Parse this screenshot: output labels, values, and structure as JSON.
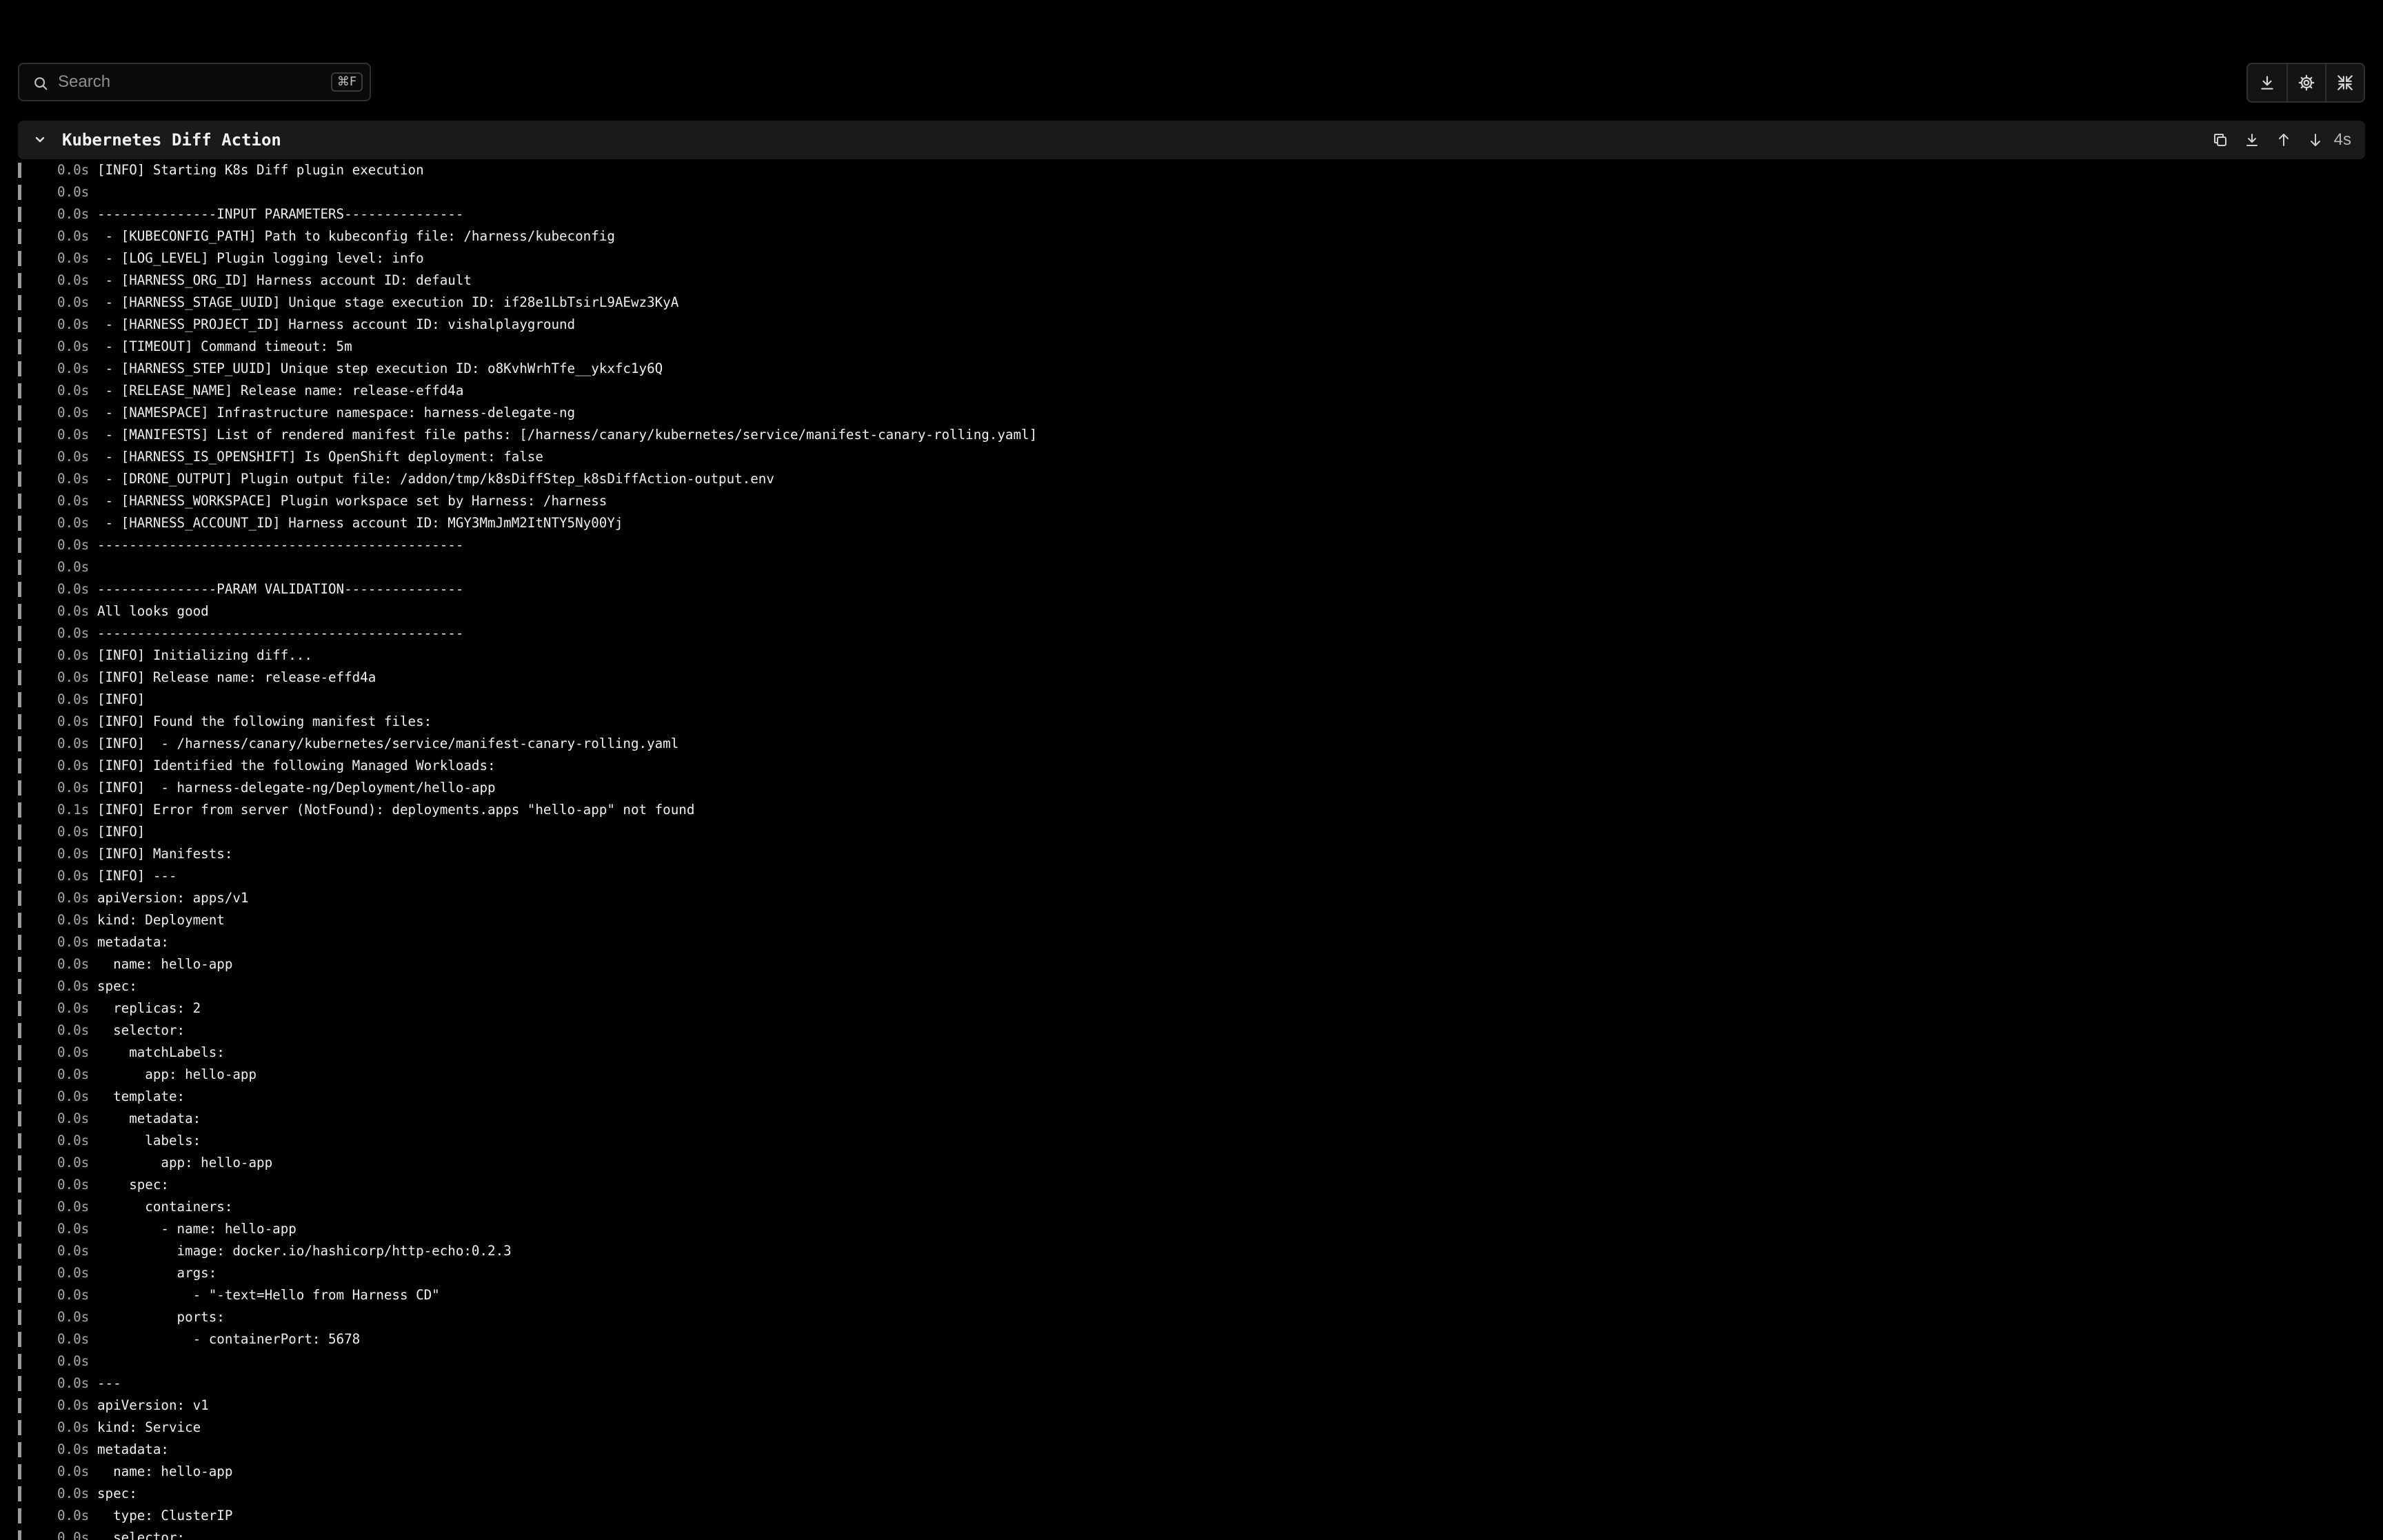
{
  "search": {
    "placeholder": "Search",
    "shortcut": "⌘F"
  },
  "toolbar": {
    "download_icon": "download-icon",
    "settings_icon": "gear-icon",
    "collapse_icon": "collapse-arrows-icon"
  },
  "section": {
    "title": "Kubernetes Diff Action",
    "duration": "4s"
  },
  "colors": {
    "background": "#000000",
    "header_bg": "#1a1a1a",
    "text": "#f0f0f0",
    "muted": "#a8a8a8"
  },
  "log": [
    {
      "time": "0.0s",
      "text": "[INFO] Starting K8s Diff plugin execution"
    },
    {
      "time": "0.0s",
      "text": ""
    },
    {
      "time": "0.0s",
      "text": "---------------INPUT PARAMETERS---------------"
    },
    {
      "time": "0.0s",
      "text": " - [KUBECONFIG_PATH] Path to kubeconfig file: /harness/kubeconfig"
    },
    {
      "time": "0.0s",
      "text": " - [LOG_LEVEL] Plugin logging level: info"
    },
    {
      "time": "0.0s",
      "text": " - [HARNESS_ORG_ID] Harness account ID: default"
    },
    {
      "time": "0.0s",
      "text": " - [HARNESS_STAGE_UUID] Unique stage execution ID: if28e1LbTsirL9AEwz3KyA"
    },
    {
      "time": "0.0s",
      "text": " - [HARNESS_PROJECT_ID] Harness account ID: vishalplayground"
    },
    {
      "time": "0.0s",
      "text": " - [TIMEOUT] Command timeout: 5m"
    },
    {
      "time": "0.0s",
      "text": " - [HARNESS_STEP_UUID] Unique step execution ID: o8KvhWrhTfe__ykxfc1y6Q"
    },
    {
      "time": "0.0s",
      "text": " - [RELEASE_NAME] Release name: release-effd4a"
    },
    {
      "time": "0.0s",
      "text": " - [NAMESPACE] Infrastructure namespace: harness-delegate-ng"
    },
    {
      "time": "0.0s",
      "text": " - [MANIFESTS] List of rendered manifest file paths: [/harness/canary/kubernetes/service/manifest-canary-rolling.yaml]"
    },
    {
      "time": "0.0s",
      "text": " - [HARNESS_IS_OPENSHIFT] Is OpenShift deployment: false"
    },
    {
      "time": "0.0s",
      "text": " - [DRONE_OUTPUT] Plugin output file: /addon/tmp/k8sDiffStep_k8sDiffAction-output.env"
    },
    {
      "time": "0.0s",
      "text": " - [HARNESS_WORKSPACE] Plugin workspace set by Harness: /harness"
    },
    {
      "time": "0.0s",
      "text": " - [HARNESS_ACCOUNT_ID] Harness account ID: MGY3MmJmM2ItNTY5Ny00Yj"
    },
    {
      "time": "0.0s",
      "text": "----------------------------------------------"
    },
    {
      "time": "0.0s",
      "text": ""
    },
    {
      "time": "0.0s",
      "text": "---------------PARAM VALIDATION---------------"
    },
    {
      "time": "0.0s",
      "text": "All looks good"
    },
    {
      "time": "0.0s",
      "text": "----------------------------------------------"
    },
    {
      "time": "0.0s",
      "text": "[INFO] Initializing diff..."
    },
    {
      "time": "0.0s",
      "text": "[INFO] Release name: release-effd4a"
    },
    {
      "time": "0.0s",
      "text": "[INFO]"
    },
    {
      "time": "0.0s",
      "text": "[INFO] Found the following manifest files:"
    },
    {
      "time": "0.0s",
      "text": "[INFO]  - /harness/canary/kubernetes/service/manifest-canary-rolling.yaml"
    },
    {
      "time": "0.0s",
      "text": "[INFO] Identified the following Managed Workloads:"
    },
    {
      "time": "0.0s",
      "text": "[INFO]  - harness-delegate-ng/Deployment/hello-app"
    },
    {
      "time": "0.1s",
      "text": "[INFO] Error from server (NotFound): deployments.apps \"hello-app\" not found"
    },
    {
      "time": "0.0s",
      "text": "[INFO]"
    },
    {
      "time": "0.0s",
      "text": "[INFO] Manifests:"
    },
    {
      "time": "0.0s",
      "text": "[INFO] ---"
    },
    {
      "time": "0.0s",
      "text": "apiVersion: apps/v1"
    },
    {
      "time": "0.0s",
      "text": "kind: Deployment"
    },
    {
      "time": "0.0s",
      "text": "metadata:"
    },
    {
      "time": "0.0s",
      "text": "  name: hello-app"
    },
    {
      "time": "0.0s",
      "text": "spec:"
    },
    {
      "time": "0.0s",
      "text": "  replicas: 2"
    },
    {
      "time": "0.0s",
      "text": "  selector:"
    },
    {
      "time": "0.0s",
      "text": "    matchLabels:"
    },
    {
      "time": "0.0s",
      "text": "      app: hello-app"
    },
    {
      "time": "0.0s",
      "text": "  template:"
    },
    {
      "time": "0.0s",
      "text": "    metadata:"
    },
    {
      "time": "0.0s",
      "text": "      labels:"
    },
    {
      "time": "0.0s",
      "text": "        app: hello-app"
    },
    {
      "time": "0.0s",
      "text": "    spec:"
    },
    {
      "time": "0.0s",
      "text": "      containers:"
    },
    {
      "time": "0.0s",
      "text": "        - name: hello-app"
    },
    {
      "time": "0.0s",
      "text": "          image: docker.io/hashicorp/http-echo:0.2.3"
    },
    {
      "time": "0.0s",
      "text": "          args:"
    },
    {
      "time": "0.0s",
      "text": "            - \"-text=Hello from Harness CD\""
    },
    {
      "time": "0.0s",
      "text": "          ports:"
    },
    {
      "time": "0.0s",
      "text": "            - containerPort: 5678"
    },
    {
      "time": "0.0s",
      "text": ""
    },
    {
      "time": "0.0s",
      "text": "---"
    },
    {
      "time": "0.0s",
      "text": "apiVersion: v1"
    },
    {
      "time": "0.0s",
      "text": "kind: Service"
    },
    {
      "time": "0.0s",
      "text": "metadata:"
    },
    {
      "time": "0.0s",
      "text": "  name: hello-app"
    },
    {
      "time": "0.0s",
      "text": "spec:"
    },
    {
      "time": "0.0s",
      "text": "  type: ClusterIP"
    },
    {
      "time": "0.0s",
      "text": "  selector:"
    }
  ]
}
